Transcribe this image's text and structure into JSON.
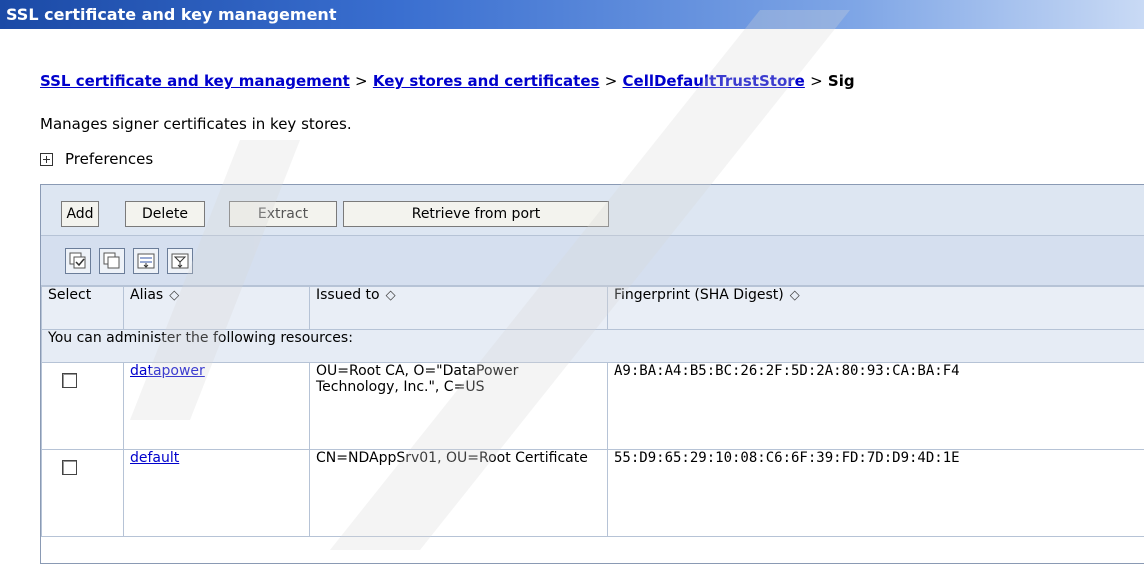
{
  "window": {
    "title": "SSL certificate and key management"
  },
  "breadcrumb": {
    "items": [
      "SSL certificate and key management",
      "Key stores and certificates",
      "CellDefaultTrustStore"
    ],
    "separator": ">",
    "current": "Sig"
  },
  "description": "Manages signer certificates in key stores.",
  "preferences": {
    "label": "Preferences"
  },
  "toolbar": {
    "add": "Add",
    "delete": "Delete",
    "extract": "Extract",
    "retrieve": "Retrieve from port"
  },
  "table": {
    "headers": {
      "select": "Select",
      "alias": "Alias",
      "issued_to": "Issued to",
      "fingerprint": "Fingerprint (SHA Digest)"
    },
    "resource_note": "You can administer the following resources:",
    "rows": [
      {
        "alias": "datapower",
        "issued_to": "OU=Root CA, O=\"DataPower Technology, Inc.\", C=US",
        "fingerprint": "A9:BA:A4:B5:BC:26:2F:5D:2A:80:93:CA:BA:F4"
      },
      {
        "alias": "default",
        "issued_to": "CN=NDAppSrv01, OU=Root Certificate",
        "fingerprint": "55:D9:65:29:10:08:C6:6F:39:FD:7D:D9:4D:1E"
      }
    ]
  },
  "icons": {
    "iconbar": [
      "select-all-icon",
      "deselect-all-icon",
      "show-filter-icon",
      "clear-filter-icon"
    ],
    "sort": "sort-arrows-icon"
  },
  "colors": {
    "title_bar": "#1b4aa6",
    "link": "#0000cc",
    "toolbar_bg": "#dde6f2"
  }
}
